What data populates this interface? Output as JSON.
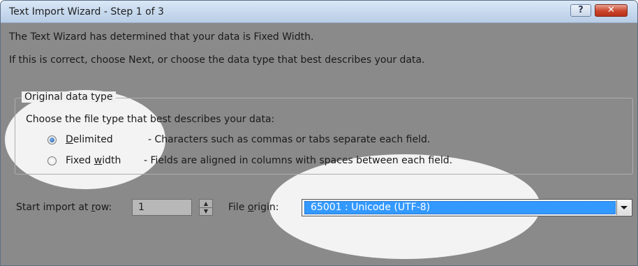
{
  "window": {
    "title": "Text Import Wizard - Step 1 of 3",
    "help_label": "?",
    "close_label": "✕"
  },
  "intro": {
    "line1": "The Text Wizard has determined that your data is Fixed Width.",
    "line2": "If this is correct, choose Next, or choose the data type that best describes your data."
  },
  "original_data_type": {
    "legend": "Original data type",
    "prompt": "Choose the file type that best describes your data:",
    "options": [
      {
        "label": "Delimited",
        "description": "- Characters such as commas or tabs separate each field.",
        "selected": true
      },
      {
        "label": "Fixed width",
        "description": "- Fields are aligned in columns with spaces between each field.",
        "selected": false
      }
    ]
  },
  "start_row": {
    "label": "Start import at row:",
    "value": "1"
  },
  "file_origin": {
    "label": "File origin:",
    "value": "65001 : Unicode (UTF-8)"
  },
  "colors": {
    "highlight": "#3399ff",
    "close_button": "#c9452b",
    "title_bar": "#c8daee",
    "dim_overlay": "#8a8a8a",
    "spotlight": "#f3f3f3"
  }
}
